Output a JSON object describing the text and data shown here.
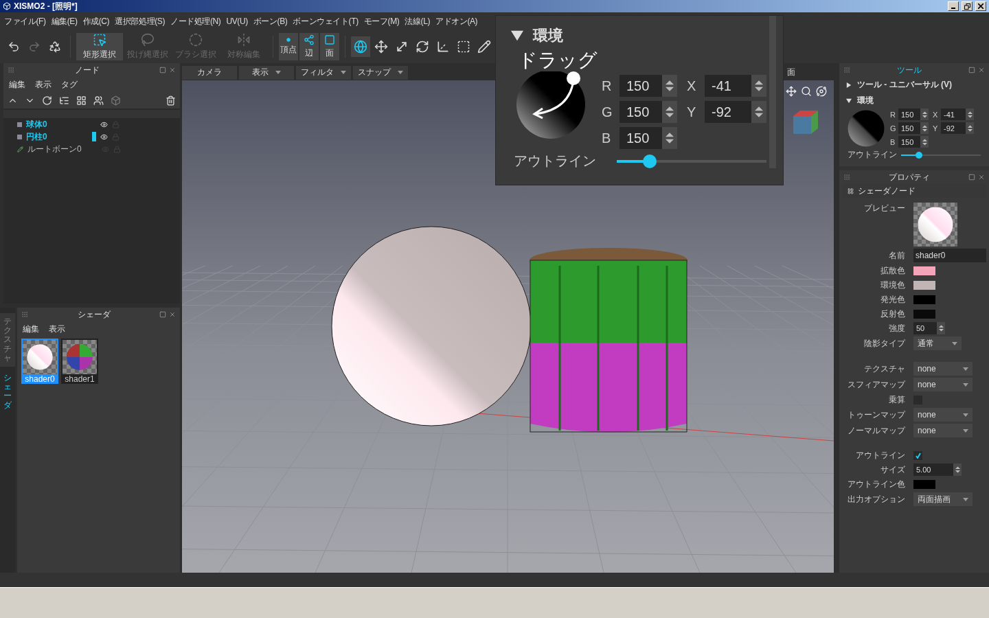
{
  "window": {
    "title": "XISMO2 - [照明*]"
  },
  "menu": [
    "ファイル(F)",
    "編集(E)",
    "作成(C)",
    "選択部処理(S)",
    "ノード処理(N)",
    "UV(U)",
    "ボーン(B)",
    "ボーンウェイト(T)",
    "モーフ(M)",
    "法線(L)",
    "アドオン(A)"
  ],
  "selection_tools": [
    {
      "label": "矩形選択",
      "selected": true,
      "disabled": false
    },
    {
      "label": "投げ縄選択",
      "selected": false,
      "disabled": true
    },
    {
      "label": "ブラシ選択",
      "selected": false,
      "disabled": true
    },
    {
      "label": "対称編集",
      "selected": false,
      "disabled": true
    }
  ],
  "element_modes": [
    {
      "label": "頂点",
      "selected": true
    },
    {
      "label": "辺",
      "selected": true
    },
    {
      "label": "面",
      "selected": true
    }
  ],
  "transform_tools": [
    {
      "selected": true
    },
    {
      "selected": false
    },
    {
      "selected": false
    },
    {
      "selected": false
    },
    {
      "selected": false
    },
    {
      "selected": false
    },
    {
      "selected": false
    }
  ],
  "node_panel": {
    "title": "ノード",
    "menu": [
      "編集",
      "表示",
      "タグ"
    ],
    "nodes": [
      {
        "name": "球体0",
        "kind": "mesh",
        "selected": true,
        "marked": false,
        "visible": true
      },
      {
        "name": "円柱0",
        "kind": "mesh",
        "selected": true,
        "marked": true,
        "visible": true
      },
      {
        "name": "ルートボーン0",
        "kind": "bone",
        "selected": false,
        "marked": false,
        "visible": false
      }
    ]
  },
  "shader_panel": {
    "side_tabs": [
      {
        "label": "テクスチャ",
        "selected": false
      },
      {
        "label": "シェーダ",
        "selected": true
      }
    ],
    "title": "シェーダ",
    "menu": [
      "編集",
      "表示"
    ],
    "shaders": [
      {
        "name": "shader0",
        "kind": "plain",
        "selected": true
      },
      {
        "name": "shader1",
        "kind": "textured",
        "selected": false
      }
    ]
  },
  "viewport": {
    "tabs": [
      {
        "label": "カメラ",
        "dropdown": false
      },
      {
        "label": "表示",
        "dropdown": true
      },
      {
        "label": "フィルタ",
        "dropdown": true
      },
      {
        "label": "スナップ",
        "dropdown": true
      }
    ],
    "view_label": "面"
  },
  "zoom_callout": {
    "section": "環境",
    "expanded": true,
    "hint": "ドラッグ",
    "rgb": [
      {
        "label": "R",
        "value": "150"
      },
      {
        "label": "G",
        "value": "150"
      },
      {
        "label": "B",
        "value": "150"
      }
    ],
    "xy": [
      {
        "label": "X",
        "value": "-41"
      },
      {
        "label": "Y",
        "value": "-92"
      }
    ],
    "outline": {
      "label": "アウトライン",
      "level": 0.22
    }
  },
  "tool_panel": {
    "title": "ツール",
    "sections": [
      {
        "label": "ツール - ユニバーサル (V)",
        "expanded": false
      },
      {
        "label": "環境",
        "expanded": true
      }
    ],
    "rgb": [
      {
        "label": "R",
        "value": "150"
      },
      {
        "label": "G",
        "value": "150"
      },
      {
        "label": "B",
        "value": "150"
      }
    ],
    "xy": [
      {
        "label": "X",
        "value": "-41"
      },
      {
        "label": "Y",
        "value": "-92"
      }
    ],
    "outline": {
      "label": "アウトライン",
      "level": 0.22
    }
  },
  "properties": {
    "title": "プロパティ",
    "section": "シェーダノード",
    "preview_label": "プレビュー",
    "groups": [
      [
        {
          "kind": "text",
          "label": "名前",
          "value": "shader0"
        },
        {
          "kind": "color",
          "label": "拡散色",
          "color": "#f4a4b8"
        },
        {
          "kind": "color",
          "label": "環境色",
          "color": "#c0b4b4"
        },
        {
          "kind": "color",
          "label": "発光色",
          "color": "#000000"
        },
        {
          "kind": "color",
          "label": "反射色",
          "color": "#0a0a0a"
        },
        {
          "kind": "spin",
          "label": "強度",
          "value": "50"
        },
        {
          "kind": "select",
          "label": "陰影タイプ",
          "value": "通常"
        }
      ],
      [
        {
          "kind": "select",
          "label": "テクスチャ",
          "value": "none"
        },
        {
          "kind": "select",
          "label": "スフィアマップ",
          "value": "none"
        },
        {
          "kind": "check",
          "label": "乗算",
          "checked": false
        },
        {
          "kind": "select",
          "label": "トゥーンマップ",
          "value": "none"
        },
        {
          "kind": "select",
          "label": "ノーマルマップ",
          "value": "none"
        }
      ],
      [
        {
          "kind": "check",
          "label": "アウトライン",
          "checked": true
        },
        {
          "kind": "spin",
          "label": "サイズ",
          "value": "5.00"
        },
        {
          "kind": "color",
          "label": "アウトライン色",
          "color": "#000000"
        },
        {
          "kind": "select",
          "label": "出力オプション",
          "value": "両面描画"
        }
      ]
    ]
  }
}
